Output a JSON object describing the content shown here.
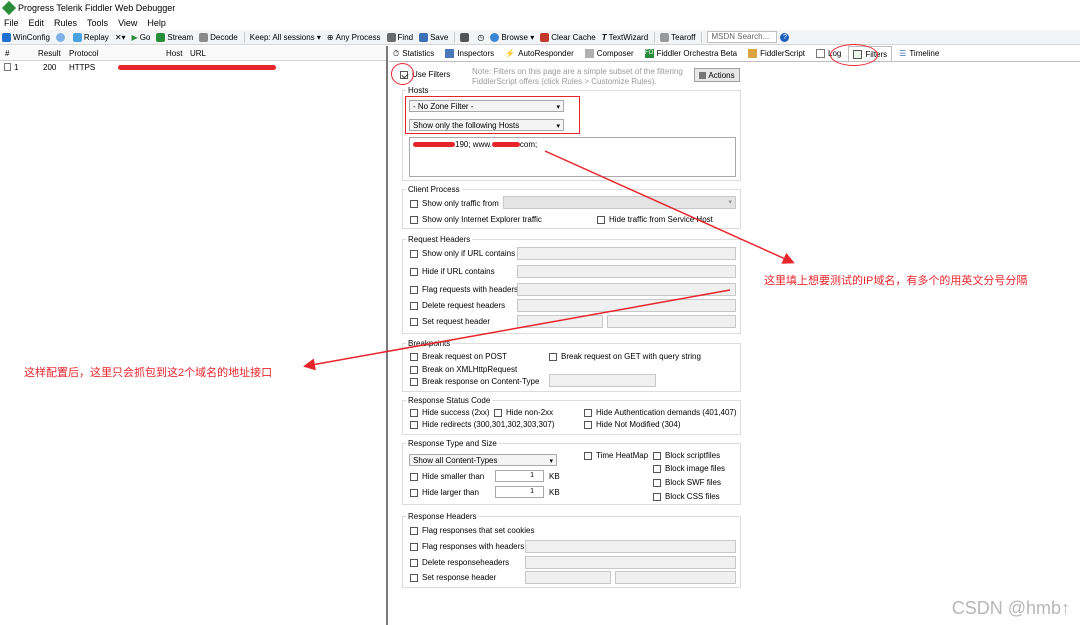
{
  "window": {
    "title": "Progress Telerik Fiddler Web Debugger"
  },
  "menu": [
    "File",
    "Edit",
    "Rules",
    "Tools",
    "View",
    "Help"
  ],
  "toolbar": {
    "winconfig": "WinConfig",
    "replay": "Replay",
    "go": "Go",
    "stream": "Stream",
    "decode": "Decode",
    "keep": "Keep: All sessions",
    "any_process": "Any Process",
    "find": "Find",
    "save": "Save",
    "browse": "Browse",
    "clear_cache": "Clear Cache",
    "textwizard": "TextWizard",
    "tearoff": "Tearoff",
    "search_placeholder": "MSDN Search..."
  },
  "sessions": {
    "columns": [
      "#",
      "Result",
      "Protocol",
      "Host",
      "URL"
    ],
    "rows": [
      {
        "num": "1",
        "result": "200",
        "protocol": "HTTPS"
      }
    ]
  },
  "tabs": [
    "Statistics",
    "Inspectors",
    "AutoResponder",
    "Composer",
    "Fiddler Orchestra Beta",
    "FiddlerScript",
    "Log",
    "Filters",
    "Timeline"
  ],
  "filters": {
    "use_filters": "Use Filters",
    "note": "Note: Filters on this page are a simple subset of the filtering FiddlerScript offers (click Rules > Customize Rules).",
    "actions": "Actions",
    "hosts": {
      "label": "Hosts",
      "zone": "- No Zone Filter -",
      "mode": "Show only the following Hosts",
      "value_end1": "190; www.",
      "value_end2": "com;"
    },
    "client_process": {
      "label": "Client Process",
      "show_only_traffic_from": "Show only traffic from",
      "show_only_ie": "Show only Internet Explorer traffic",
      "hide_service_host": "Hide traffic from Service Host"
    },
    "request_headers": {
      "label": "Request Headers",
      "url_contains": "Show only if URL contains",
      "hide_url_contains": "Hide if URL contains",
      "flag_headers": "Flag requests with headers",
      "delete_headers": "Delete request headers",
      "set_header": "Set request header"
    },
    "breakpoints": {
      "label": "Breakpoints",
      "break_post": "Break request on POST",
      "break_get_qs": "Break request on GET with query string",
      "break_xhr": "Break on XMLHttpRequest",
      "break_content_type": "Break response on Content-Type"
    },
    "response_status": {
      "label": "Response Status Code",
      "hide_success": "Hide success (2xx)",
      "hide_non2xx": "Hide non-2xx",
      "hide_auth": "Hide Authentication demands (401,407)",
      "hide_redirects": "Hide redirects (300,301,302,303,307)",
      "hide_not_modified": "Hide Not Modified (304)"
    },
    "response_type": {
      "label": "Response Type and Size",
      "content_types": "Show all Content-Types",
      "time_heatmap": "Time HeatMap",
      "block_script": "Block scriptfiles",
      "block_image": "Block image files",
      "block_swf": "Block SWF files",
      "block_css": "Block CSS files",
      "hide_smaller": "Hide smaller than",
      "hide_larger": "Hide larger than",
      "size1": "1",
      "size2": "1",
      "unit": "KB"
    },
    "response_headers": {
      "label": "Response Headers",
      "flag_cookies": "Flag responses that set cookies",
      "flag_headers": "Flag responses with headers",
      "delete_headers": "Delete responseheaders",
      "set_header": "Set response header"
    }
  },
  "annotations": {
    "right": "这里填上想要测试的IP域名，有多个的用英文分号分隔",
    "left": "这样配置后，这里只会抓包到这2个域名的地址接口"
  },
  "watermark": "CSDN @hmb↑",
  "colors": {
    "annotation_red": "#e8242b",
    "fiddler_green": "#2a8d3c"
  }
}
